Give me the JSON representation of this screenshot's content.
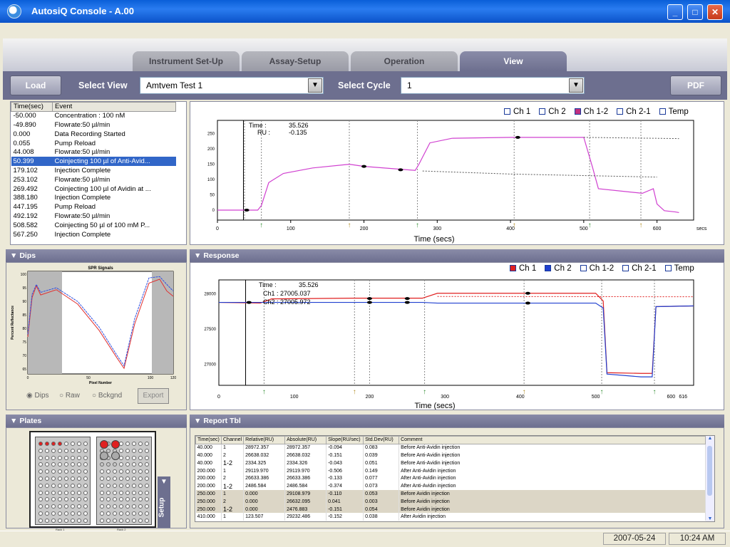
{
  "window": {
    "title": "AutosiQ Console - A.00",
    "min": "_",
    "max": "□",
    "close": "✕"
  },
  "tabs": [
    {
      "label": "Instrument Set-Up",
      "active": false
    },
    {
      "label": "Assay-Setup",
      "active": false
    },
    {
      "label": "Operation",
      "active": false
    },
    {
      "label": "View",
      "active": true
    }
  ],
  "toolbar": {
    "load": "Load",
    "select_view_label": "Select  View",
    "select_view_value": "Amtvem Test 1",
    "select_cycle_label": "Select  Cycle",
    "select_cycle_value": "1",
    "pdf": "PDF"
  },
  "events": {
    "columns": [
      "Time(sec)",
      "Event"
    ],
    "rows": [
      [
        "-50.000",
        "Concentration : 100 nM"
      ],
      [
        "-49.890",
        "Flowrate:50 µl/min"
      ],
      [
        "0.000",
        "Data Recording Started"
      ],
      [
        "0.055",
        "Pump Reload"
      ],
      [
        "44.008",
        "Flowrate:50 µl/min"
      ],
      [
        "50.399",
        "Coinjecting 100 µl of Anti-Avid..."
      ],
      [
        "179.102",
        "Injection Complete"
      ],
      [
        "253.102",
        "Flowrate:50 µl/min"
      ],
      [
        "269.492",
        "Coinjecting 100 µl of Avidin at ..."
      ],
      [
        "388.180",
        "Injection Complete"
      ],
      [
        "447.195",
        "Pump Reload"
      ],
      [
        "492.192",
        "Flowrate:50 µl/min"
      ],
      [
        "508.582",
        "Coinjecting 50 µl of 100 mM P..."
      ],
      [
        "567.250",
        "Injection Complete"
      ]
    ],
    "selected_index": 5
  },
  "top_chart": {
    "legend": [
      "Ch 1",
      "Ch 2",
      "Ch 1-2",
      "Ch 2-1",
      "Temp"
    ],
    "legend_checked": [
      false,
      false,
      true,
      false,
      false
    ],
    "readout_time_label": "Time :",
    "readout_time": "35.526",
    "readout_ru_label": "RU :",
    "readout_ru": "-0.135",
    "xlabel": "Time (secs)",
    "x_ticks": [
      "0",
      "100",
      "200",
      "300",
      "400",
      "500",
      "600"
    ],
    "x_unit": "secs",
    "y_ticks": [
      "250",
      "200",
      "150",
      "100",
      "50",
      "0"
    ]
  },
  "dips": {
    "title": "Dips",
    "chart_title": "SPR Signals",
    "ylabel": "Percent Reflectance",
    "xlabel": "Pixel Number",
    "y_ticks": [
      "100",
      "95",
      "90",
      "85",
      "80",
      "75",
      "70",
      "65"
    ],
    "x_ticks": [
      "0",
      "50",
      "100",
      "120"
    ],
    "radios": [
      "Dips",
      "Raw",
      "Bckgnd"
    ],
    "selected_radio": "Dips",
    "export": "Export"
  },
  "response": {
    "title": "Response",
    "legend": [
      "Ch 1",
      "Ch 2",
      "Ch 1-2",
      "Ch 2-1",
      "Temp"
    ],
    "legend_checked": [
      true,
      true,
      false,
      false,
      false
    ],
    "colors": {
      "ch1": "#e02020",
      "ch2": "#2040d0"
    },
    "readout_time_label": "Time :",
    "readout_time": "35.526",
    "readout_ch1": "Ch1 : 27005.037",
    "readout_ch2": "Ch2 : 27005.972",
    "xlabel": "Time (secs)",
    "x_ticks": [
      "0",
      "100",
      "200",
      "300",
      "400",
      "500",
      "600",
      "616"
    ],
    "y_ticks": [
      "28000",
      "27500",
      "27000"
    ]
  },
  "plates": {
    "title": "Plates",
    "setup_label": "Setup",
    "rack1": "Rack 1",
    "rack2": "Rack 2"
  },
  "report": {
    "title": "Report Tbl",
    "columns": [
      "Time(sec)",
      "Channel",
      "Relative(RU)",
      "Absolute(RU)",
      "Slope(RU/sec)",
      "Std.Dev(RU)",
      "Comment"
    ],
    "rows": [
      [
        "40.000",
        "1",
        "28972.357",
        "28972.357",
        "-0.094",
        "0.083",
        "Before Anti-Avidin injection"
      ],
      [
        "40.000",
        "2",
        "26638.032",
        "26638.032",
        "-0.151",
        "0.039",
        "Before Anti-Avidin injection"
      ],
      [
        "40.000",
        "1-2",
        "2334.325",
        "2334.326",
        "-0.043",
        "0.051",
        "Before Anti-Avidin injection"
      ],
      [
        "200.000",
        "1",
        "29119.970",
        "29119.970",
        "-0.506",
        "0.149",
        "After Anti-Avidin injection"
      ],
      [
        "200.000",
        "2",
        "26633.386",
        "26633.386",
        "-0.133",
        "0.077",
        "After Anti-Avidin injection"
      ],
      [
        "200.000",
        "1-2",
        "2486.584",
        "2486.584",
        "-0.374",
        "0.073",
        "After Anti-Avidin injection"
      ],
      [
        "250.000",
        "1",
        "0.000",
        "29108.979",
        "-0.110",
        "0.053",
        "Before Avidin injection"
      ],
      [
        "250.000",
        "2",
        "0.000",
        "26632.095",
        "0.041",
        "0.003",
        "Before Avidin injection"
      ],
      [
        "250.000",
        "1-2",
        "0.000",
        "2476.883",
        "-0.151",
        "0.054",
        "Before Avidin injection"
      ],
      [
        "410.000",
        "1",
        "123.507",
        "29232.486",
        "-0.152",
        "0.038",
        "After Avidin injection"
      ]
    ]
  },
  "status": {
    "date": "2007-05-24",
    "time": "10:24 AM"
  }
}
